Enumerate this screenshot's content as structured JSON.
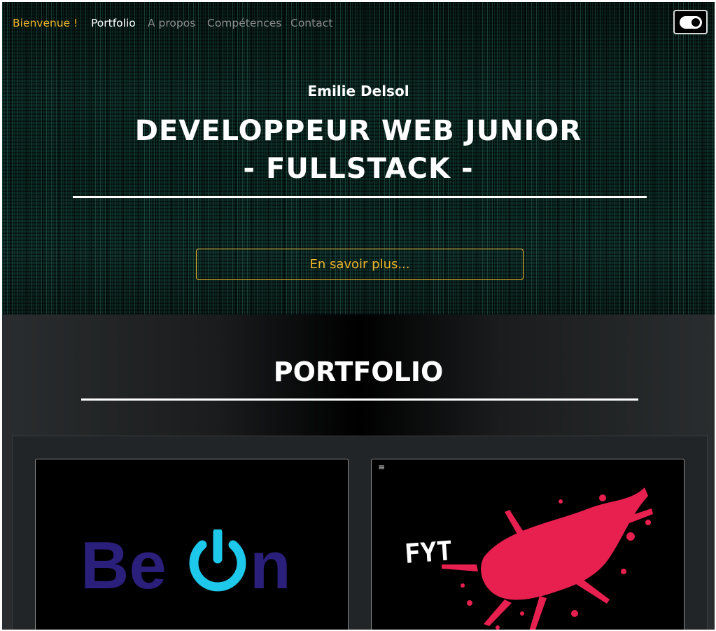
{
  "nav": {
    "brand": "Bienvenue !",
    "links": [
      {
        "label": "Portfolio",
        "active": true
      },
      {
        "label": "A propos",
        "active": false
      },
      {
        "label": "Compétences",
        "active": false
      },
      {
        "label": "Contact",
        "active": false
      }
    ],
    "theme_toggle_icon": "toggle-icon"
  },
  "hero": {
    "name": "Emilie Delsol",
    "title_line1": "DEVELOPPEUR WEB JUNIOR",
    "title_line2": "- FULLSTACK -",
    "cta_label": "En savoir plus..."
  },
  "portfolio": {
    "title": "PORTFOLIO",
    "projects": [
      {
        "logo_text_1": "Be",
        "logo_text_2": "n",
        "logo_icon": "power-icon"
      },
      {
        "logo_text": "FYT",
        "menu_icon": "hamburger-menu-icon"
      }
    ]
  },
  "colors": {
    "accent": "#f0b429",
    "beon_dark": "#2a1f7a",
    "beon_power": "#1ec8ea",
    "fyt_splash": "#e8204f"
  }
}
